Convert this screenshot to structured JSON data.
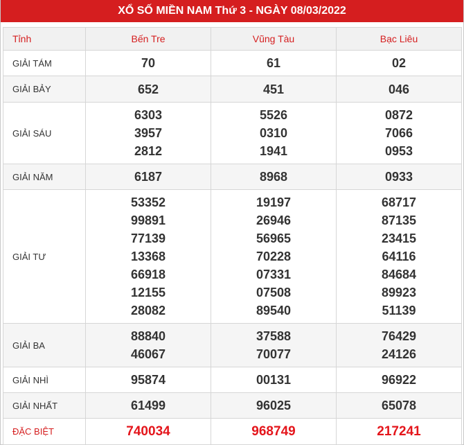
{
  "title": "XỔ SỐ MIỀN NAM Thứ 3 - NGÀY 08/03/2022",
  "header": {
    "label": "Tỉnh",
    "provinces": [
      "Bến Tre",
      "Vũng Tàu",
      "Bạc Liêu"
    ]
  },
  "prizes": [
    {
      "name": "GIẢI TÁM",
      "results": [
        [
          "70"
        ],
        [
          "61"
        ],
        [
          "02"
        ]
      ]
    },
    {
      "name": "GIẢI BẢY",
      "results": [
        [
          "652"
        ],
        [
          "451"
        ],
        [
          "046"
        ]
      ]
    },
    {
      "name": "GIẢI SÁU",
      "results": [
        [
          "6303",
          "3957",
          "2812"
        ],
        [
          "5526",
          "0310",
          "1941"
        ],
        [
          "0872",
          "7066",
          "0953"
        ]
      ]
    },
    {
      "name": "GIẢI NĂM",
      "results": [
        [
          "6187"
        ],
        [
          "8968"
        ],
        [
          "0933"
        ]
      ]
    },
    {
      "name": "GIẢI TƯ",
      "results": [
        [
          "53352",
          "99891",
          "77139",
          "13368",
          "66918",
          "12155",
          "28082"
        ],
        [
          "19197",
          "26946",
          "56965",
          "70228",
          "07331",
          "07508",
          "89540"
        ],
        [
          "68717",
          "87135",
          "23415",
          "64116",
          "84684",
          "89923",
          "51139"
        ]
      ]
    },
    {
      "name": "GIẢI BA",
      "results": [
        [
          "88840",
          "46067"
        ],
        [
          "37588",
          "70077"
        ],
        [
          "76429",
          "24126"
        ]
      ]
    },
    {
      "name": "GIẢI NHÌ",
      "results": [
        [
          "95874"
        ],
        [
          "00131"
        ],
        [
          "96922"
        ]
      ]
    },
    {
      "name": "GIẢI NHẤT",
      "results": [
        [
          "61499"
        ],
        [
          "96025"
        ],
        [
          "65078"
        ]
      ]
    },
    {
      "name": "ĐẶC BIỆT",
      "results": [
        [
          "740034"
        ],
        [
          "968749"
        ],
        [
          "217241"
        ]
      ]
    }
  ]
}
